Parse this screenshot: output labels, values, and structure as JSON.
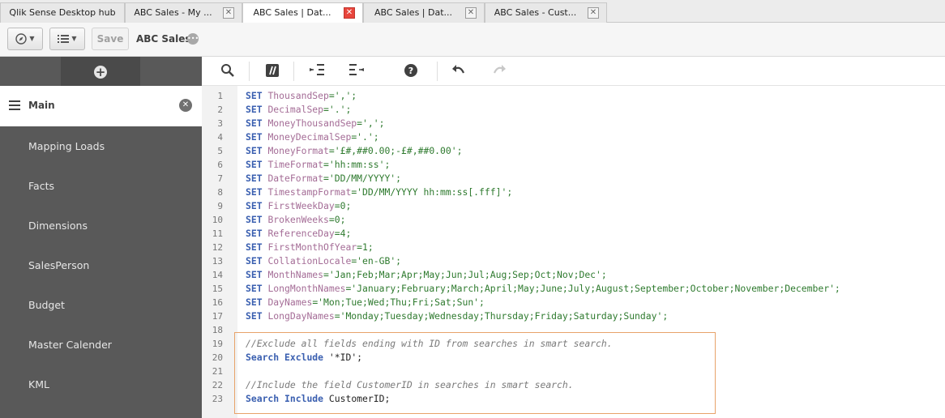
{
  "tabs": [
    {
      "label": "Qlik Sense Desktop hub",
      "closable": false,
      "active": false
    },
    {
      "label": "ABC Sales - My ...",
      "closable": true,
      "active": false
    },
    {
      "label": "ABC Sales | Dat...",
      "closable": true,
      "active": true
    },
    {
      "label": "ABC Sales | Dat...",
      "closable": true,
      "active": false
    },
    {
      "label": "ABC Sales - Cust...",
      "closable": true,
      "active": false
    }
  ],
  "toolbar": {
    "save_label": "Save",
    "app_title": "ABC Sales",
    "icons": [
      "compass-icon",
      "list-icon",
      "info-icon"
    ]
  },
  "sidebar": {
    "add_icon": "plus-circle-icon",
    "active_section": "Main",
    "items": [
      "Mapping Loads",
      "Facts",
      "Dimensions",
      "SalesPerson",
      "Budget",
      "Master Calender",
      "KML"
    ]
  },
  "editor_toolbar": {
    "icons": [
      "search-icon",
      "comment-toggle-icon",
      "indent-icon",
      "outdent-icon",
      "help-icon",
      "undo-icon",
      "redo-icon"
    ]
  },
  "code": {
    "lines": [
      [
        [
          "SET",
          "kw"
        ],
        [
          " ",
          "pl"
        ],
        [
          "ThousandSep",
          "var"
        ],
        [
          "=',';",
          "str"
        ]
      ],
      [
        [
          "SET",
          "kw"
        ],
        [
          " ",
          "pl"
        ],
        [
          "DecimalSep",
          "var"
        ],
        [
          "='.';",
          "str"
        ]
      ],
      [
        [
          "SET",
          "kw"
        ],
        [
          " ",
          "pl"
        ],
        [
          "MoneyThousandSep",
          "var"
        ],
        [
          "=',';",
          "str"
        ]
      ],
      [
        [
          "SET",
          "kw"
        ],
        [
          " ",
          "pl"
        ],
        [
          "MoneyDecimalSep",
          "var"
        ],
        [
          "='.';",
          "str"
        ]
      ],
      [
        [
          "SET",
          "kw"
        ],
        [
          " ",
          "pl"
        ],
        [
          "MoneyFormat",
          "var"
        ],
        [
          "='£#,##0.00;-£#,##0.00';",
          "str"
        ]
      ],
      [
        [
          "SET",
          "kw"
        ],
        [
          " ",
          "pl"
        ],
        [
          "TimeFormat",
          "var"
        ],
        [
          "='hh:mm:ss';",
          "str"
        ]
      ],
      [
        [
          "SET",
          "kw"
        ],
        [
          " ",
          "pl"
        ],
        [
          "DateFormat",
          "var"
        ],
        [
          "='DD/MM/YYYY';",
          "str"
        ]
      ],
      [
        [
          "SET",
          "kw"
        ],
        [
          " ",
          "pl"
        ],
        [
          "TimestampFormat",
          "var"
        ],
        [
          "='DD/MM/YYYY hh:mm:ss[.fff]';",
          "str"
        ]
      ],
      [
        [
          "SET",
          "kw"
        ],
        [
          " ",
          "pl"
        ],
        [
          "FirstWeekDay",
          "var"
        ],
        [
          "=0;",
          "str"
        ]
      ],
      [
        [
          "SET",
          "kw"
        ],
        [
          " ",
          "pl"
        ],
        [
          "BrokenWeeks",
          "var"
        ],
        [
          "=0;",
          "str"
        ]
      ],
      [
        [
          "SET",
          "kw"
        ],
        [
          " ",
          "pl"
        ],
        [
          "ReferenceDay",
          "var"
        ],
        [
          "=4;",
          "str"
        ]
      ],
      [
        [
          "SET",
          "kw"
        ],
        [
          " ",
          "pl"
        ],
        [
          "FirstMonthOfYear",
          "var"
        ],
        [
          "=1;",
          "str"
        ]
      ],
      [
        [
          "SET",
          "kw"
        ],
        [
          " ",
          "pl"
        ],
        [
          "CollationLocale",
          "var"
        ],
        [
          "='en-GB';",
          "str"
        ]
      ],
      [
        [
          "SET",
          "kw"
        ],
        [
          " ",
          "pl"
        ],
        [
          "MonthNames",
          "var"
        ],
        [
          "='Jan;Feb;Mar;Apr;May;Jun;Jul;Aug;Sep;Oct;Nov;Dec';",
          "str"
        ]
      ],
      [
        [
          "SET",
          "kw"
        ],
        [
          " ",
          "pl"
        ],
        [
          "LongMonthNames",
          "var"
        ],
        [
          "='January;February;March;April;May;June;July;August;September;October;November;December';",
          "str"
        ]
      ],
      [
        [
          "SET",
          "kw"
        ],
        [
          " ",
          "pl"
        ],
        [
          "DayNames",
          "var"
        ],
        [
          "='Mon;Tue;Wed;Thu;Fri;Sat;Sun';",
          "str"
        ]
      ],
      [
        [
          "SET",
          "kw"
        ],
        [
          " ",
          "pl"
        ],
        [
          "LongDayNames",
          "var"
        ],
        [
          "='Monday;Tuesday;Wednesday;Thursday;Friday;Saturday;Sunday';",
          "str"
        ]
      ],
      [],
      [
        [
          "//Exclude all fields ending with ID from searches in smart search.",
          "cmt"
        ]
      ],
      [
        [
          "Search",
          "kw"
        ],
        [
          " ",
          "pl"
        ],
        [
          "Exclude",
          "kw"
        ],
        [
          " '*ID';",
          "pl"
        ]
      ],
      [],
      [
        [
          "//Include the field CustomerID in searches in smart search.",
          "cmt"
        ]
      ],
      [
        [
          "Search",
          "kw"
        ],
        [
          " ",
          "pl"
        ],
        [
          "Include",
          "kw"
        ],
        [
          " CustomerID;",
          "pl"
        ]
      ]
    ]
  }
}
